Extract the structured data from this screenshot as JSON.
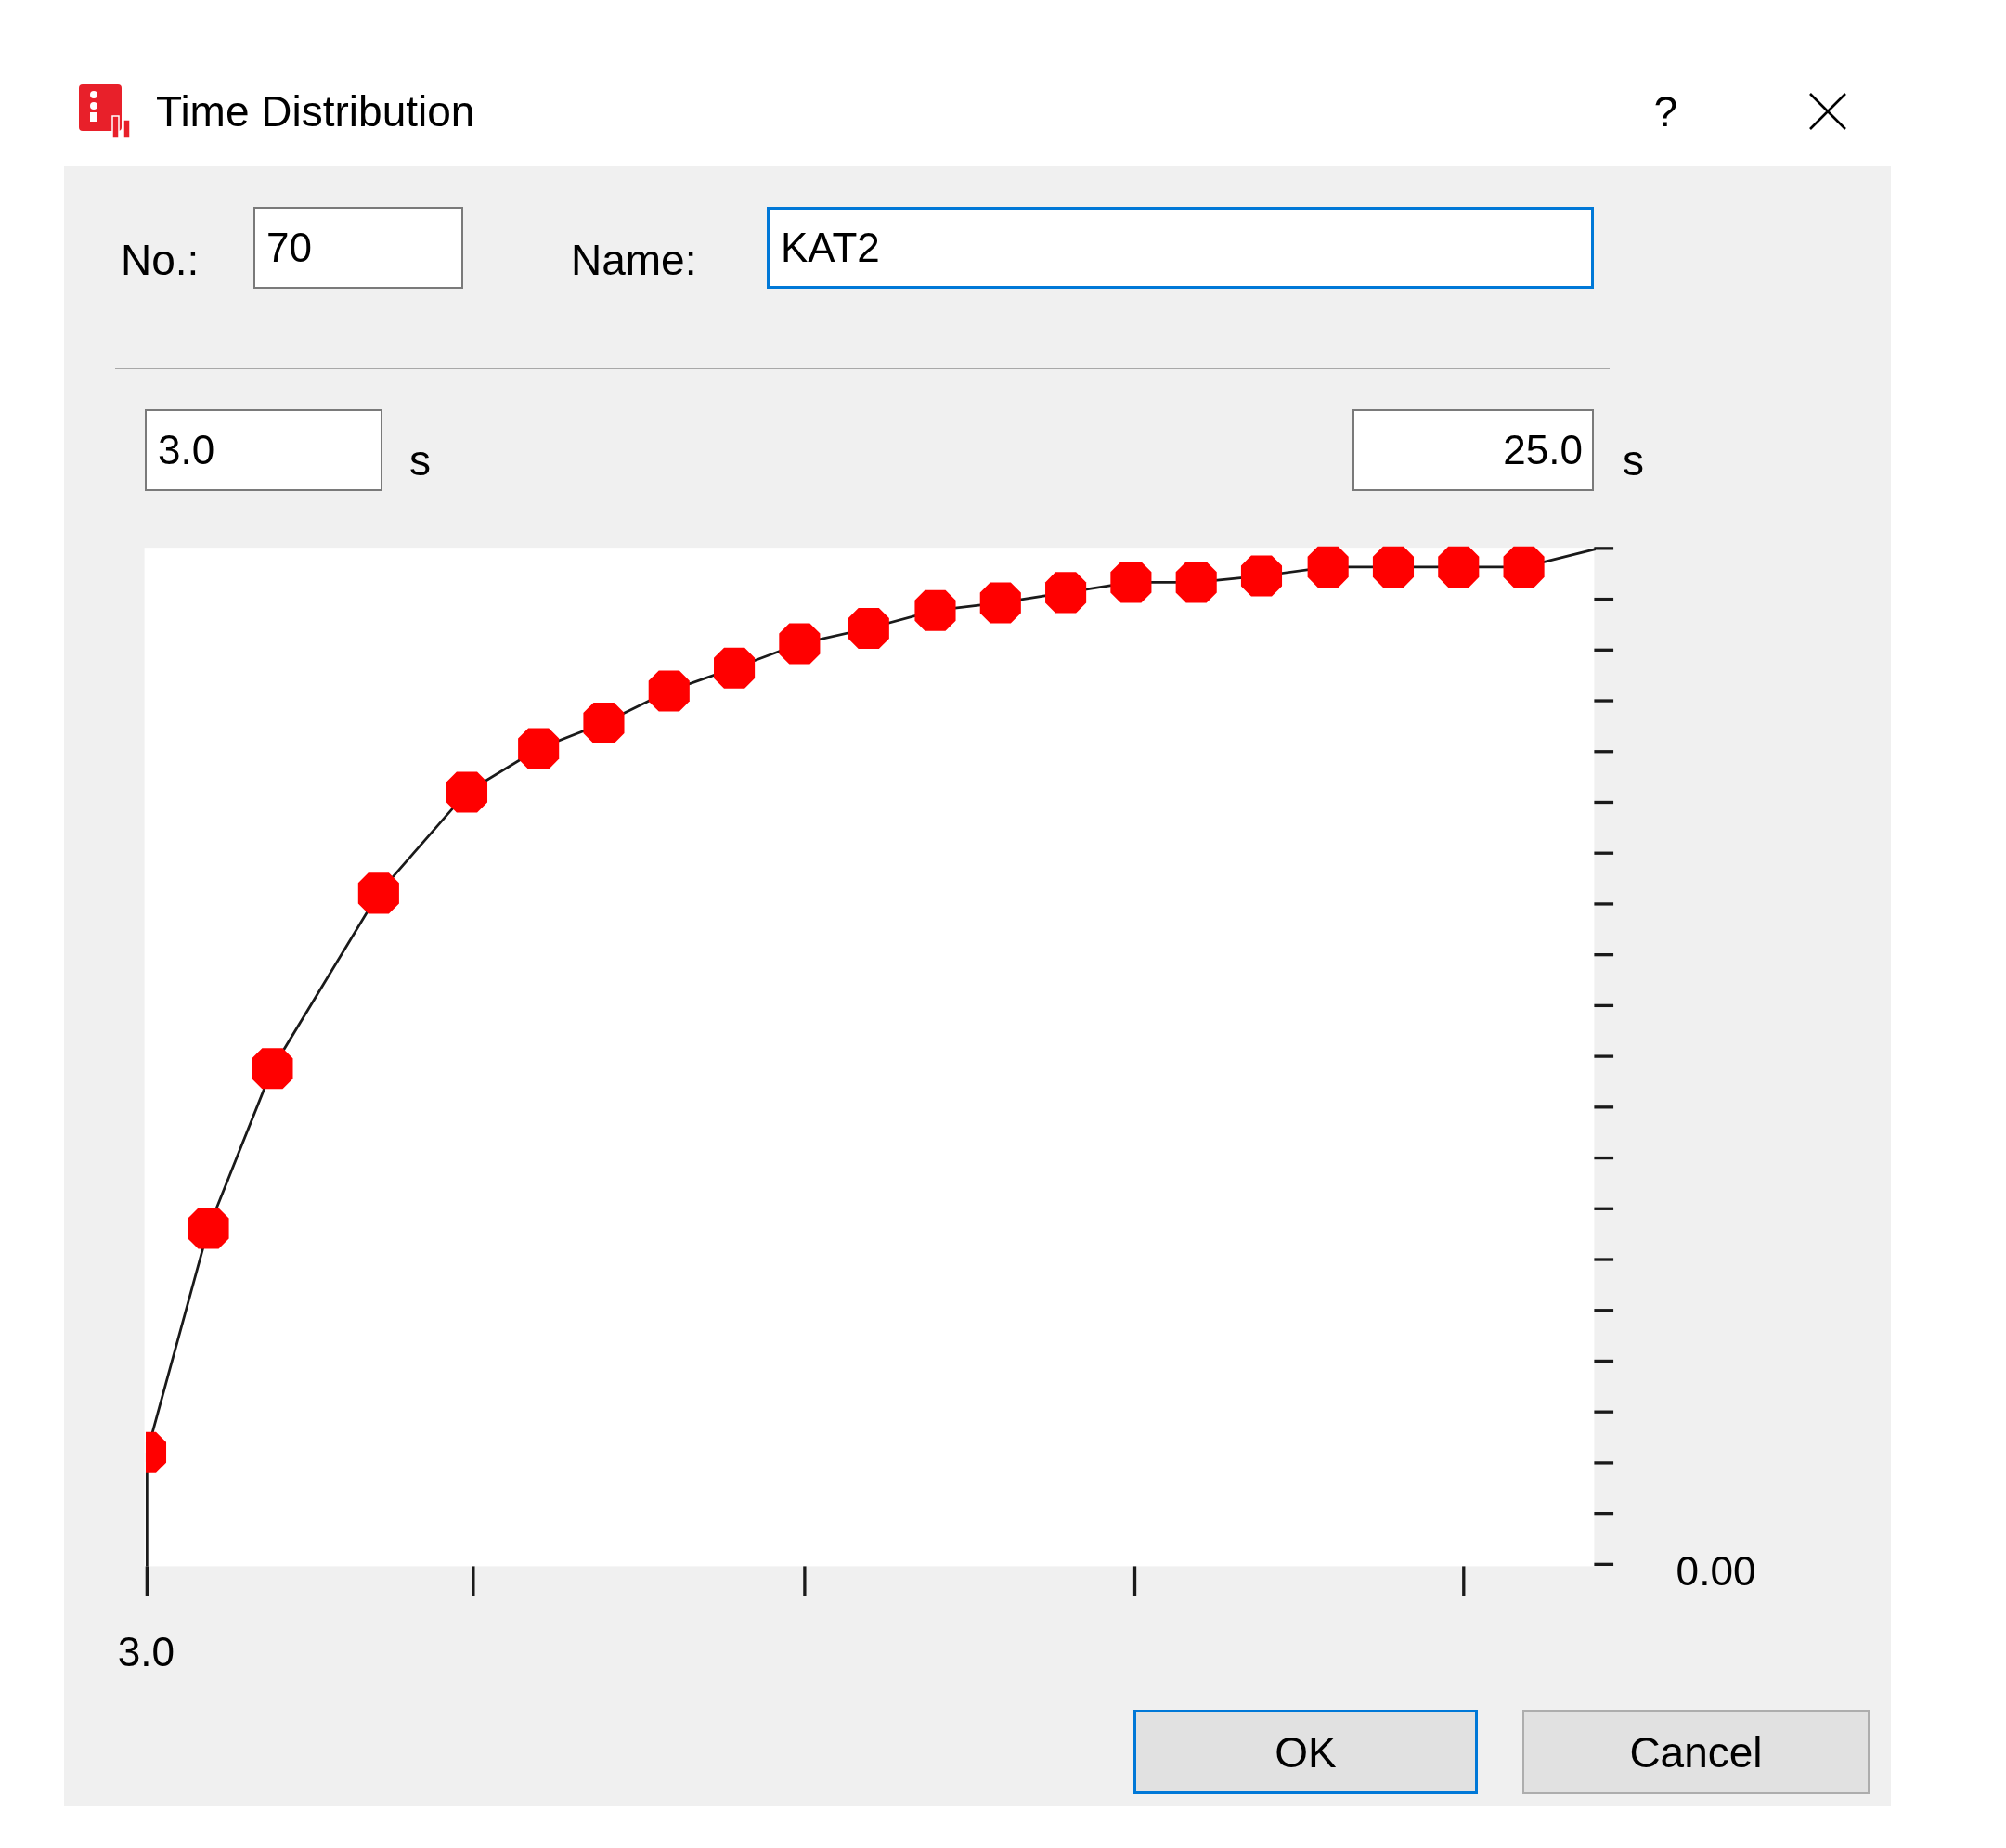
{
  "window": {
    "title": "Time Distribution",
    "help": "?"
  },
  "fields": [
    {
      "label": "No.:",
      "value": "70",
      "focused": false
    },
    {
      "label": "Name:",
      "value": "KAT2",
      "focused": true
    }
  ],
  "range": {
    "start": {
      "value": "3.0",
      "unit": "s"
    },
    "end": {
      "value": "25.0",
      "unit": "s"
    }
  },
  "chart": {
    "x_axis_label": "3.0",
    "y_axis_label": "0.00"
  },
  "buttons": [
    {
      "label": "OK",
      "default": true
    },
    {
      "label": "Cancel",
      "default": false
    }
  ]
}
